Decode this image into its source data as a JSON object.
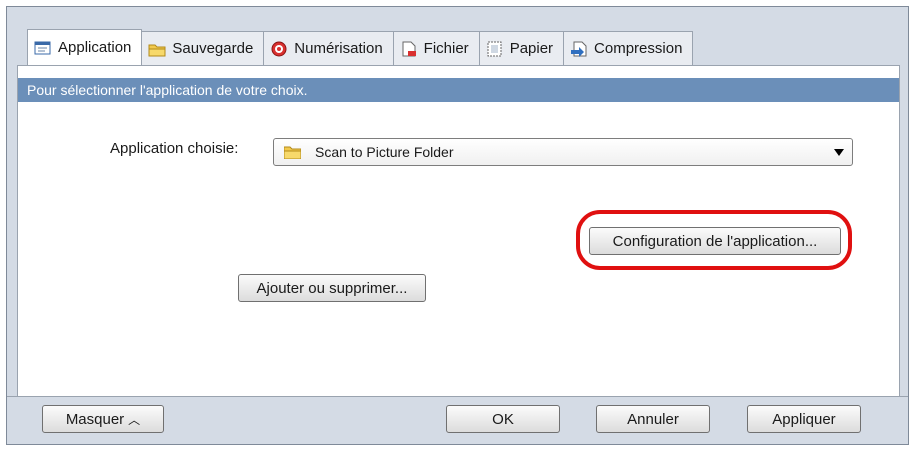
{
  "tabs": [
    {
      "label": "Application",
      "icon": "application-icon",
      "active": true
    },
    {
      "label": "Sauvegarde",
      "icon": "save-folder-icon",
      "active": false
    },
    {
      "label": "Numérisation",
      "icon": "scan-icon",
      "active": false
    },
    {
      "label": "Fichier",
      "icon": "file-icon",
      "active": false
    },
    {
      "label": "Papier",
      "icon": "paper-icon",
      "active": false
    },
    {
      "label": "Compression",
      "icon": "compression-icon",
      "active": false
    }
  ],
  "main": {
    "info_text": "Pour sélectionner l'application de votre choix.",
    "app_label": "Application choisie:",
    "selected_app": "Scan to Picture Folder",
    "config_button": "Configuration de l'application...",
    "add_remove_button": "Ajouter ou supprimer..."
  },
  "footer": {
    "hide_button": "Masquer",
    "ok_button": "OK",
    "cancel_button": "Annuler",
    "apply_button": "Appliquer"
  },
  "colors": {
    "info_bar": "#6b8fb9",
    "highlight": "#e01010",
    "window_bg": "#d4dbe5"
  }
}
